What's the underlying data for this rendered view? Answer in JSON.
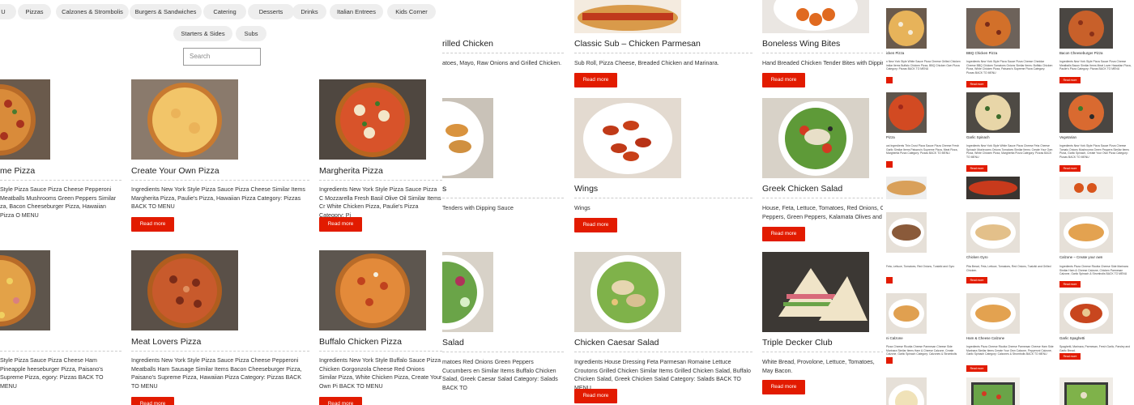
{
  "categories": {
    "row1": [
      "U",
      "Pizzas",
      "Calzones & Strombolis",
      "Burgers & Sandwiches",
      "Catering",
      "Desserts",
      "Drinks",
      "Italian Entrees",
      "Kids Corner"
    ],
    "row2": [
      "Starters & Sides",
      "Subs"
    ]
  },
  "search": {
    "placeholder": "Search"
  },
  "read_more": "Read more",
  "panel1": [
    {
      "title": "me Pizza",
      "desc": "Style Pizza Sauce Pizza Cheese Pepperoni Meatballs Mushrooms Green Peppers Similar za,  Bacon Cheeseburger Pizza, Hawaiian Pizza O MENU"
    },
    {
      "title": "Create Your Own Pizza",
      "desc": "Ingredients New York Style Pizza Sauce Pizza Cheese Similar Items  Margherita Pizza, Paulie's Pizza, Hawaiian Pizza Category: Pizzas BACK TO MENU"
    },
    {
      "title": "Margherita Pizza",
      "desc": "Ingredients New York Style Pizza Sauce Pizza C Mozzarella Fresh Basil Olive Oil Similar Items Cr White Chicken Pizza, Paulie's Pizza Category: Pi"
    },
    {
      "title": "",
      "desc": "Style Pizza Sauce Pizza Cheese Ham Pineapple heeseburger Pizza, Paisano's Supreme Pizza, egory: Pizzas BACK TO MENU"
    },
    {
      "title": "Meat Lovers Pizza",
      "desc": "Ingredients New York Style Pizza Sauce Pizza Cheese Pepperoni Meatballs Ham Sausage Similar Items Bacon Cheeseburger Pizza, Paisano's Supreme Pizza, Hawaiian Pizza   Category: Pizzas BACK TO MENU"
    },
    {
      "title": "Buffalo Chicken Pizza",
      "desc": "Ingredients New York Style Buffalo Sauce Pizza Chicken Gorgonzola Cheese Red Onions Similar Pizza, White Chicken Pizza, Create Your Own Pi BACK TO MENU"
    }
  ],
  "panel2": [
    {
      "title": "rilled Chicken",
      "desc": "atoes, Mayo, Raw Onions and Grilled Chicken."
    },
    {
      "title": "Classic Sub – Chicken Parmesan",
      "desc": "Sub Roll, Pizza Cheese, Breaded Chicken and Marinara."
    },
    {
      "title": "Boneless Wing Bites",
      "desc": "Hand Breaded Chicken Tender Bites with Dipping"
    },
    {
      "title": "s",
      "desc": "Tenders with Dipping Sauce"
    },
    {
      "title": "Wings",
      "desc": "Wings"
    },
    {
      "title": "Greek Chicken Salad",
      "desc": "House, Feta, Lettuce, Tomatoes, Red Onions, Cu Peppers, Green Peppers, Kalamata Olives and G"
    },
    {
      "title": "Salad",
      "desc": "matoes Red Onions Green Peppers Cucumbers en Similar Items Buffalo Chicken Salad, Greek Caesar Salad   Category: Salads BACK TO"
    },
    {
      "title": "Chicken Caesar Salad",
      "desc": "Ingredients House Dressing Feta Parmesan Romaine Lettuce Croutons Grilled Chicken Similar Items Grilled Chicken Salad, Buffalo Chicken Salad, Greek Chicken Salad Category: Salads BACK TO MENU"
    },
    {
      "title": "Triple Decker Club",
      "desc": "White Bread, Provolone, Lettuce, Tomatoes, May Bacon."
    }
  ],
  "panel3": [
    {
      "title": "icken Pizza",
      "desc": "n New York Style White Sauce Pizza Cheese Grilled Chicken imilar Items Buffalo Chicken Pizza, BBQ Chicken Own Pizza Category: Pizzas BACK TO MENU"
    },
    {
      "title": "BBQ Chicken Pizza",
      "desc": "Ingredients New York Style Pizza Sauce Pizza Cheese Cheddar Cheese BBQ Chicken Tomatoes Onions Similar Items: Buffalo Chicken Pizza, White Chicken Pizza, Paisano's Supreme Pizza Category: Pizzas BACK TO MENU"
    },
    {
      "title": "Bacon Cheeseburger Pizza",
      "desc": "Ingredients New York Style Pizza Sauce Pizza Cheese Meatballs Bacon Similar Items Meat Lover Hawaiian Pizza, Paulie's Pizza Category: Pizzas BACK TO MENU"
    },
    {
      "title": "Pizza",
      "desc": "ust Ingredients Thin Crust Pizza Sauce Pizza Cheese Fresh Garlic Similar Items Paisano's Supreme Pizza, Meat Pizza, Margherita Pizza Category: Pizzas BACK TO MENU"
    },
    {
      "title": "Garlic Spinach",
      "desc": "Ingredients New York Style White Sauce Pizza Cheese Feta Cheese Spinach Mushrooms Onions Tomatoes Similar Items: Create Your Own Pizza, White Chicken Pizza, Margherita Pizza Category: Pizzas BACK TO MENU"
    },
    {
      "title": "Vegetarian",
      "desc": "Ingredients New York Style Pizza Sauce Pizza Cheese Tomato Onions Mushrooms Green Peppers Similar Items Pizza, Garlic Spinach, Create Your Own Pizza Category: Pizzas BACK TO MENU"
    },
    {
      "title": "",
      "desc": "Feta, Lettuce, Tomatoes, Red Onions, Tzatziki and Gyro"
    },
    {
      "title": "Chicken Gyro",
      "desc": "Pita Bread, Feta, Lettuce, Tomatoes, Red Onions, Tzatziki and Grilled Chicken."
    },
    {
      "title": "Calzone – Create your own",
      "desc": "Ingredients Pizza Cheese Ricotta Cheese  Side Marinara Similar Ham & Cheese Calzone, Chicken Parmesan Calzone, Garlic Spinach & Strombolis BACK TO MENU"
    },
    {
      "title": "ni Calzone",
      "desc": "Pizza Cheese Ricotta Cheese Parmesan Cheese Side Marinara Similar Items Ham & Cheese Calzone, Create Calzone, Garlic Spinach   Category: Calzones & Strombolis"
    },
    {
      "title": "Ham & Cheese Calzone",
      "desc": "Ingredients Pizza Cheese Ricotta Cheese Parmesan Cheese Ham Side Marinara Similar Items Create Your Own Calzone, Pepperoni Calzone, Garlic Spinach   Category: Calzones & Strombolis BACK TO MENU"
    },
    {
      "title": "Garlic Spaghetti",
      "desc": "Spaghetti, Marinara, Parmesan, Fresh Garlic, Parsley and Garlic Bread."
    }
  ]
}
